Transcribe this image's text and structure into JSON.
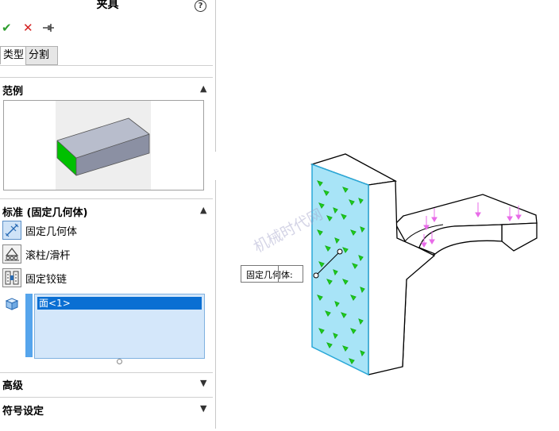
{
  "panel": {
    "title": "夹具",
    "help_label": "?",
    "tabs": [
      {
        "label": "类型",
        "active": true
      },
      {
        "label": "分割",
        "active": false
      }
    ],
    "sections": {
      "example": {
        "title": "范例"
      },
      "standard": {
        "title": "标准 (固定几何体)",
        "options": [
          {
            "label": "固定几何体",
            "icon": "fixed-geometry-icon",
            "selected": true
          },
          {
            "label": "滚柱/滑杆",
            "icon": "roller-slider-icon",
            "selected": false
          },
          {
            "label": "固定铰链",
            "icon": "fixed-hinge-icon",
            "selected": false
          }
        ],
        "selection_list": [
          "面<1>"
        ]
      },
      "advanced": {
        "title": "高级"
      },
      "symbol": {
        "title": "符号设定"
      }
    }
  },
  "viewport": {
    "annotation_label": "固定几何体:",
    "watermark": "机械时代网"
  },
  "colors": {
    "selection_blue": "#0a6fd3",
    "list_bg": "#d4e7fa",
    "face_highlight": "#a8e4f7",
    "fixture_green": "#1dd01d",
    "load_arrow": "#e86be8",
    "example_green": "#00c000"
  }
}
